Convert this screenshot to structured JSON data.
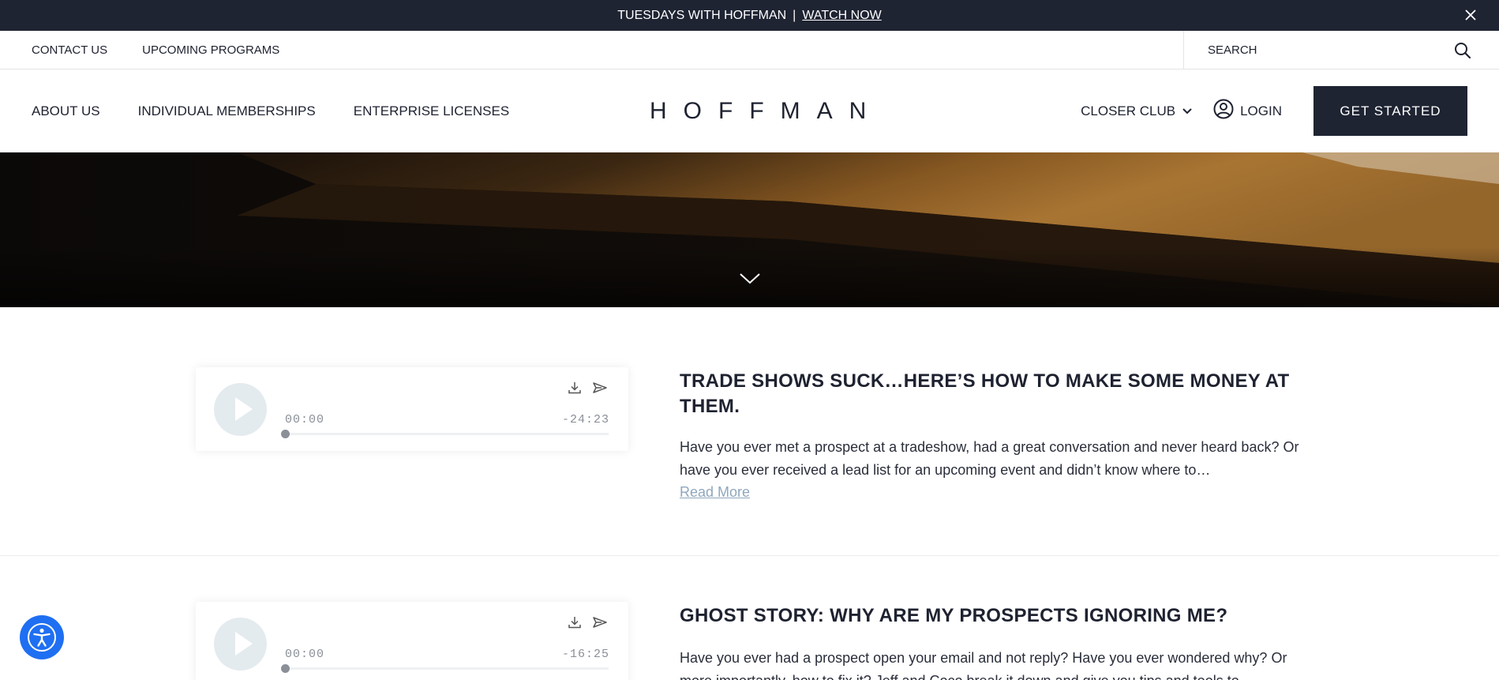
{
  "announcement": {
    "text": "TUESDAYS WITH HOFFMAN",
    "separator": "|",
    "link": "WATCH NOW",
    "close_icon": "close-icon"
  },
  "utility_nav": {
    "links": [
      "CONTACT US",
      "UPCOMING PROGRAMS"
    ],
    "search_placeholder": "SEARCH",
    "search_icon": "search-icon"
  },
  "main_nav": {
    "links": [
      "ABOUT US",
      "INDIVIDUAL MEMBERSHIPS",
      "ENTERPRISE LICENSES"
    ],
    "logo": "HOFFMAN",
    "closer_club": "CLOSER CLUB",
    "login": "LOGIN",
    "cta": "GET STARTED"
  },
  "colors": {
    "dark_navy": "#1f2433",
    "player_bg": "#e4ebef",
    "link_muted": "#8fa7bd",
    "accessibility_blue": "#1f6ff2"
  },
  "episodes": [
    {
      "title": "TRADE SHOWS SUCK…HERE’S HOW TO MAKE SOME MONEY AT THEM.",
      "description": "Have you ever met a prospect at a tradeshow, had a great conversation and never heard back? Or have you ever received a lead list for an upcoming event and didn’t know where to…",
      "read_more": "Read More",
      "current_time": "00:00",
      "remaining_time": "-24:23",
      "progress": 0
    },
    {
      "title": "GHOST STORY: WHY ARE MY PROSPECTS IGNORING ME?",
      "description": "Have you ever had a prospect open your email and not reply? Have you ever wondered why? Or more importantly, how to fix it? Jeff and Coco break it down and give you tips and tools to",
      "current_time": "00:00",
      "remaining_time": "-16:25",
      "progress": 0
    }
  ]
}
